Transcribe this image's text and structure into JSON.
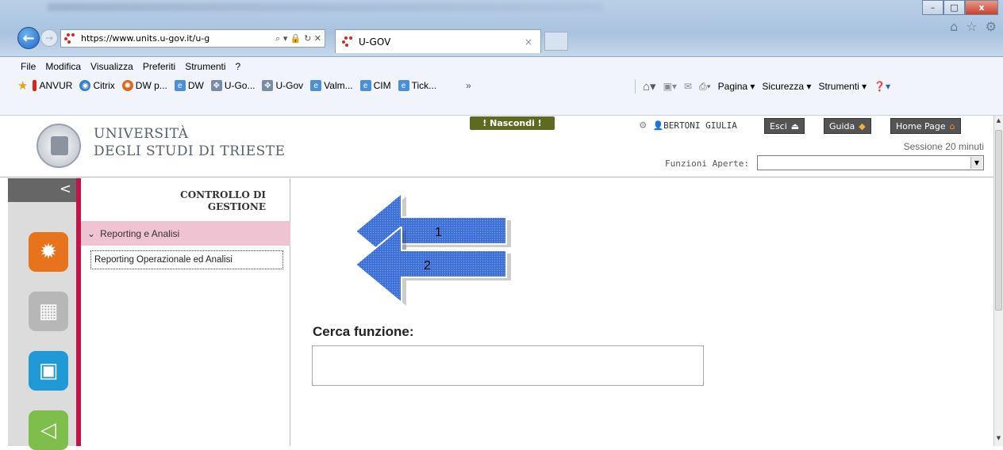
{
  "browser": {
    "address": "https://www.units.u-gov.it/u-g",
    "tab_title": "U-GOV",
    "tab_close": "×",
    "window_buttons": [
      "–",
      "□",
      "x"
    ],
    "right_icons": [
      "home-icon",
      "star-icon",
      "gear-icon"
    ]
  },
  "menu": [
    "File",
    "Modifica",
    "Visualizza",
    "Preferiti",
    "Strumenti",
    "?"
  ],
  "favorites": [
    {
      "label": "ANVUR",
      "color": "#d9261c"
    },
    {
      "label": "Citrix",
      "color": "#2f7fd1"
    },
    {
      "label": "DW p...",
      "color": "#d86a1f"
    },
    {
      "label": "DW",
      "color": "#4a90d9"
    },
    {
      "label": "U-Go...",
      "color": "#7a8ca5"
    },
    {
      "label": "U-Gov",
      "color": "#7a8ca5"
    },
    {
      "label": "Valm...",
      "color": "#4a90d9"
    },
    {
      "label": "CIM",
      "color": "#4a90d9"
    },
    {
      "label": "Tick...",
      "color": "#4a90d9"
    }
  ],
  "favorites_overflow": "»",
  "commands": [
    "Pagina ▾",
    "Sicurezza ▾",
    "Strumenti ▾"
  ],
  "header": {
    "university_line1": "UNIVERSITÀ",
    "university_line2": "DEGLI STUDI DI TRIESTE",
    "hide_button": "! Nascondi !",
    "user_name": "BERTONI GIULIA",
    "exit_button": "Esci",
    "guide_button": "Guida",
    "home_button": "Home Page",
    "session": "Sessione 20 minuti",
    "open_functions_label": "Funzioni Aperte:",
    "open_functions_value": ""
  },
  "sidebar": {
    "collapse": "<",
    "title_line1": "CONTROLLO DI",
    "title_line2": "GESTIONE",
    "section": "Reporting e Analisi",
    "item": "Reporting Operazionale ed Analisi"
  },
  "annotations": {
    "arrow1": "1",
    "arrow2": "2"
  },
  "content": {
    "search_label": "Cerca funzione:",
    "search_value": ""
  },
  "colors": {
    "accent_red": "#c0144b",
    "section_pink": "#f0c3d3",
    "orange_app": "#e8731d",
    "blue_app": "#1f9ad6",
    "green_app": "#7dbf4a"
  }
}
